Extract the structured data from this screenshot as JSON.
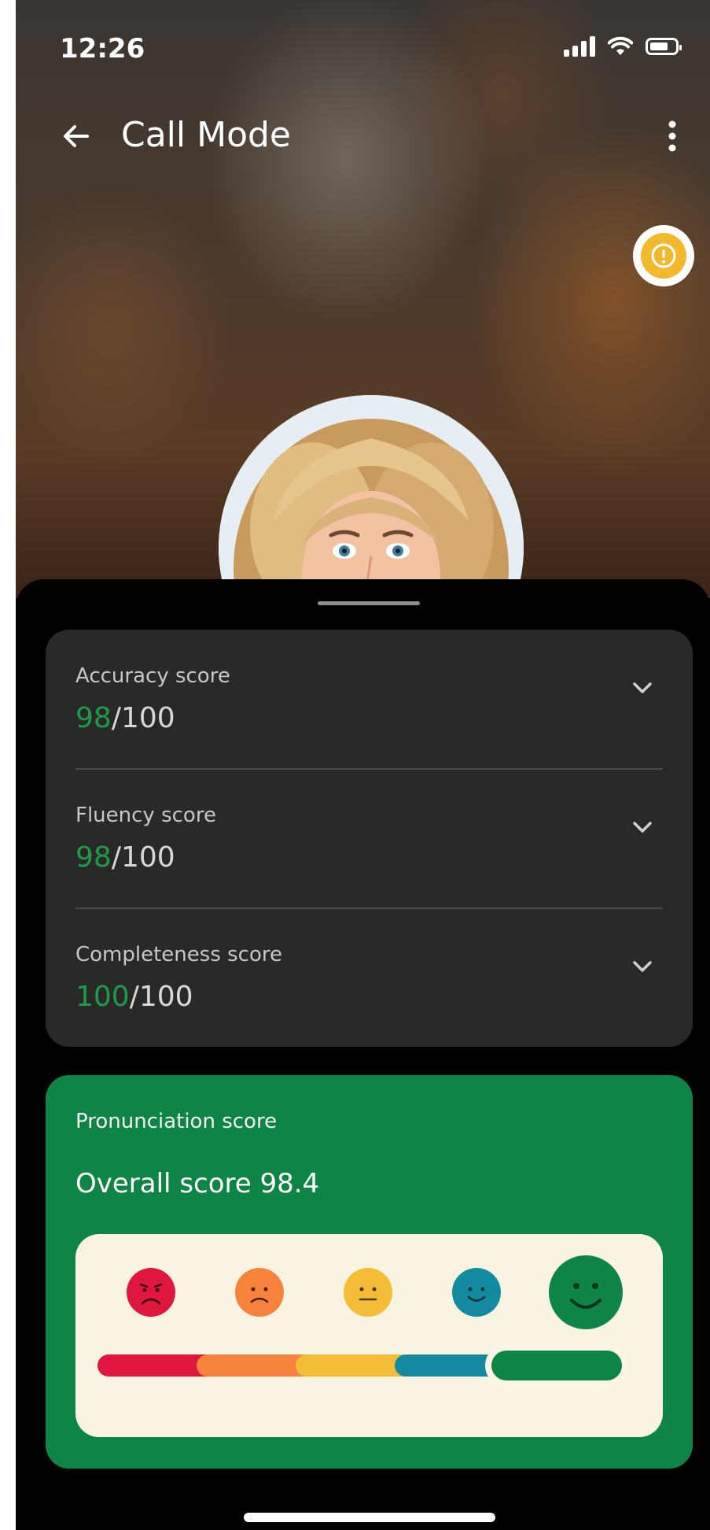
{
  "status_bar": {
    "time": "12:26"
  },
  "header": {
    "title": "Call Mode"
  },
  "scores": [
    {
      "label": "Accuracy score",
      "value": "98",
      "max": "/100"
    },
    {
      "label": "Fluency score",
      "value": "98",
      "max": "/100"
    },
    {
      "label": "Completeness score",
      "value": "100",
      "max": "/100"
    }
  ],
  "pronunciation": {
    "label": "Pronunciation score",
    "overall": "Overall score 98.4",
    "level_percent": 98.4
  },
  "colors": {
    "green": "#0f8447",
    "score_highlight": "#1f9a4d",
    "red": "#e0163f",
    "orange": "#f7823b",
    "yellow": "#f4bd35",
    "teal": "#138a9f",
    "alert": "#f3b92c"
  }
}
